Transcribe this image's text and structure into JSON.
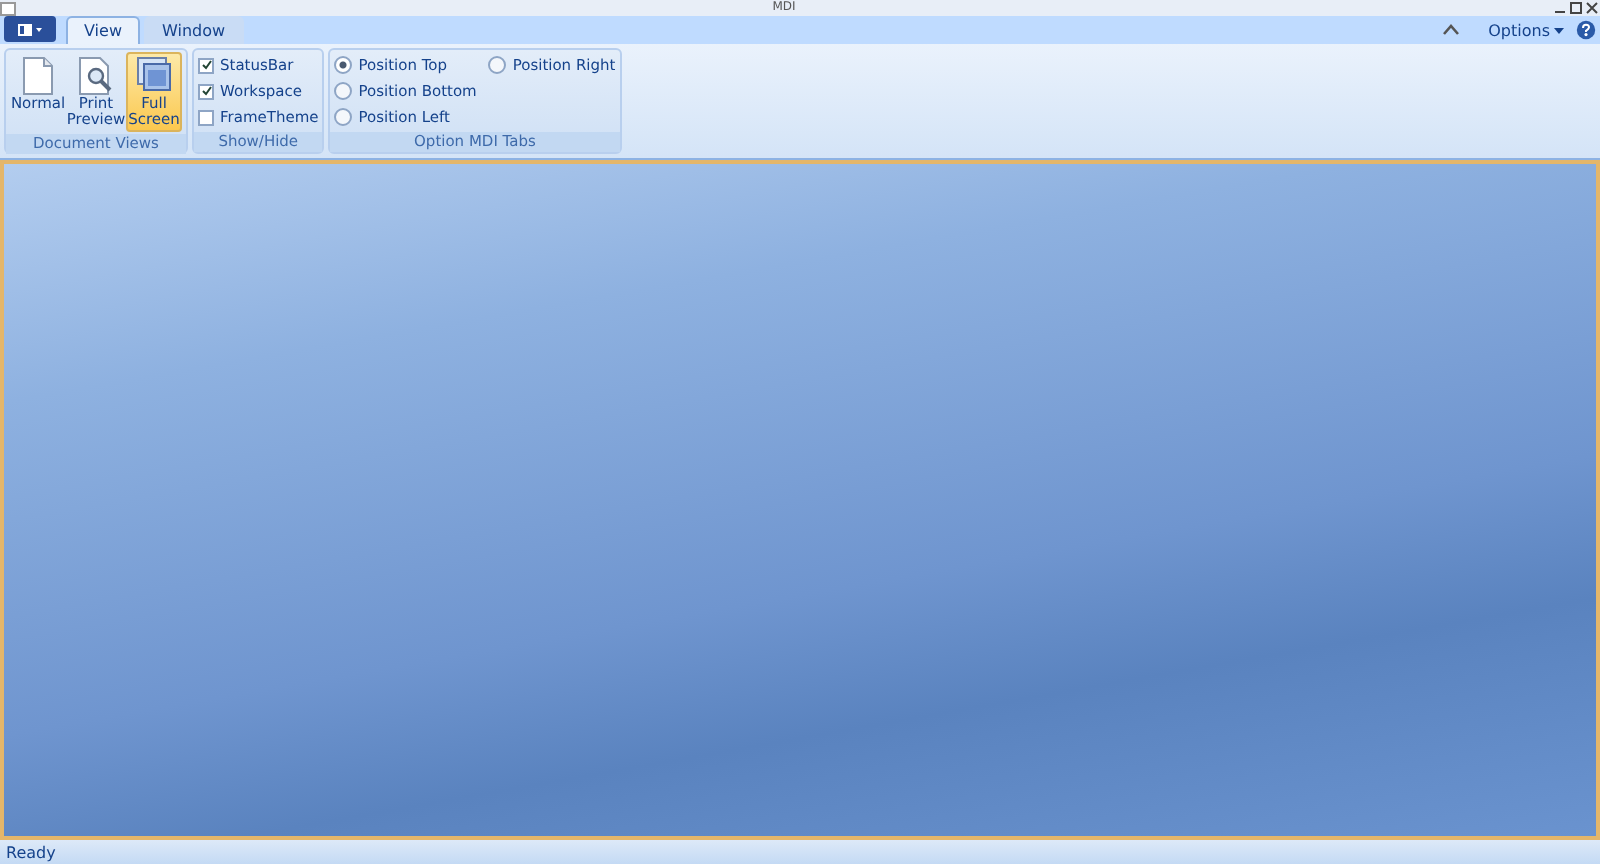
{
  "window": {
    "title": "MDI"
  },
  "tabs": [
    {
      "label": "View",
      "selected": true
    },
    {
      "label": "Window",
      "selected": false
    }
  ],
  "options_menu": {
    "label": "Options"
  },
  "groups": [
    {
      "label": "Document Views",
      "kind": "buttons",
      "items": [
        {
          "label": "Normal",
          "selected": false
        },
        {
          "label": "Print Preview",
          "selected": false
        },
        {
          "label": "Full Screen",
          "selected": true
        }
      ]
    },
    {
      "label": "Show/Hide",
      "kind": "checks",
      "items": [
        {
          "label": "StatusBar",
          "checked": true
        },
        {
          "label": "Workspace",
          "checked": true
        },
        {
          "label": "FrameTheme",
          "checked": false
        }
      ]
    },
    {
      "label": "Option MDI Tabs",
      "kind": "radios",
      "items": [
        {
          "label": "Position Top",
          "selected": true
        },
        {
          "label": "Position Bottom",
          "selected": false
        },
        {
          "label": "Position Left",
          "selected": false
        },
        {
          "label": "Position Right",
          "selected": false
        }
      ]
    }
  ],
  "status_bar": {
    "text": "Ready"
  }
}
